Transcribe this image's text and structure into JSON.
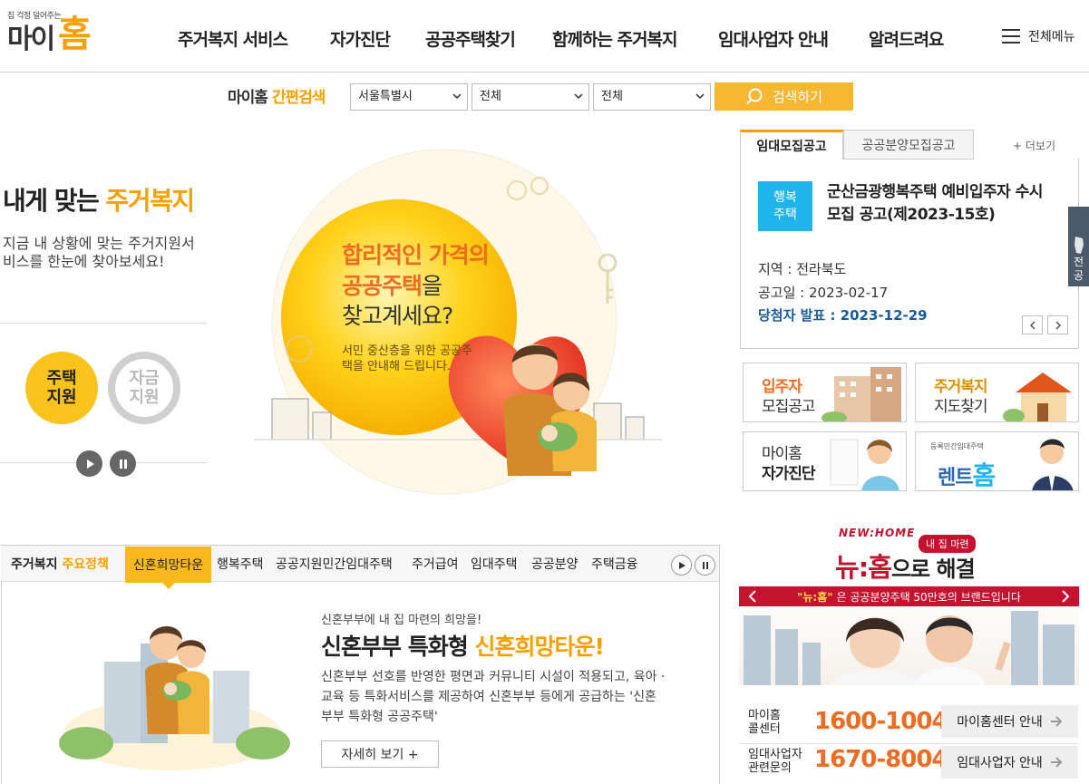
{
  "logo": {
    "tagline": "집 걱정 덜어주는",
    "part1": "마이",
    "part2": "홈"
  },
  "nav": [
    {
      "label": "주거복지 서비스"
    },
    {
      "label": "자가진단"
    },
    {
      "label": "공공주택찾기"
    },
    {
      "label": "함께하는 주거복지"
    },
    {
      "label": "임대사업자 안내"
    },
    {
      "label": "알려드려요"
    }
  ],
  "all_menu": "전체메뉴",
  "quick_search": {
    "title_a": "마이홈",
    "title_b": "간편검색",
    "region": "서울특별시",
    "type1": "전체",
    "type2": "전체",
    "button": "검색하기"
  },
  "left": {
    "title_a": "내게 맞는",
    "title_b": "주거복지",
    "desc": "지금 내 상황에 맞는 주거지원서비스를 한눈에 찾아보세요!",
    "circle1": [
      "주택",
      "지원"
    ],
    "circle2": [
      "자금",
      "지원"
    ]
  },
  "hero": {
    "line1": "합리적인 가격의",
    "line2_em": "공공주택",
    "line2_rest": "을",
    "line3": "찾고계세요?",
    "sub": "서민 중산층을 위한 공공주택을 안내해 드립니다."
  },
  "notice": {
    "tab1": "임대모집공고",
    "tab2": "공공분양모집공고",
    "more": "+ 더보기",
    "badge": [
      "행복",
      "주택"
    ],
    "title": "군산금광행복주택 예비입주자 수시 모집 공고(제2023-15호)",
    "region": "지역 : 전라북도",
    "date": "공고일 : 2023-02-17",
    "announce": "당첨자 발표 : 2023-12-29"
  },
  "side_tab": [
    "전",
    "공"
  ],
  "banners": {
    "b1": [
      "입주자",
      "모집공고"
    ],
    "b2": [
      "주거복지",
      "지도찾기"
    ],
    "b3": [
      "마이홈",
      "자가진단"
    ],
    "b4_small": "등록민간임대주택",
    "b4_a": "렌트",
    "b4_b": "홈"
  },
  "policy": {
    "title_a": "주거복지",
    "title_b": "주요정책",
    "active_tab": "신혼희망타운",
    "tabs": [
      "행복주택",
      "공공지원민간임대주택",
      "주거급여",
      "임대주택",
      "공공분양",
      "주택금융"
    ],
    "kicker": "신혼부부에 내 집 마련의 희망을!",
    "head_a": "신혼부부 특화형",
    "head_b": "신혼희망타운!",
    "desc": "신혼부부 선호를 반영한 평면과 커뮤니티 시설이 적용되고, 육아 · 교육 등 특화서비스를 제공하여 신혼부부 등에게 공급하는 '신혼부부 특화형 공공주택'",
    "more": "자세히 보기 +"
  },
  "promo": {
    "brand": "NEW:HOME",
    "badge": "내 집 마련",
    "head_a": "뉴:홈",
    "head_b": "으로 해결",
    "strip_em": "\"뉴:홈\"",
    "strip_rest": "은 공공분양주택 50만호의 브랜드입니다"
  },
  "callcenter": [
    {
      "label": [
        "마이홈",
        "콜센터"
      ],
      "number": "1600-1004",
      "button": "마이홈센터 안내"
    },
    {
      "label": [
        "임대사업자",
        "관련문의"
      ],
      "number": "1670-8004",
      "button": "임대사업자 안내"
    }
  ],
  "colors": {
    "accent": "#f4a000",
    "orange": "#ee6b22",
    "cyan": "#1fb4ea",
    "red": "#c4122f"
  }
}
